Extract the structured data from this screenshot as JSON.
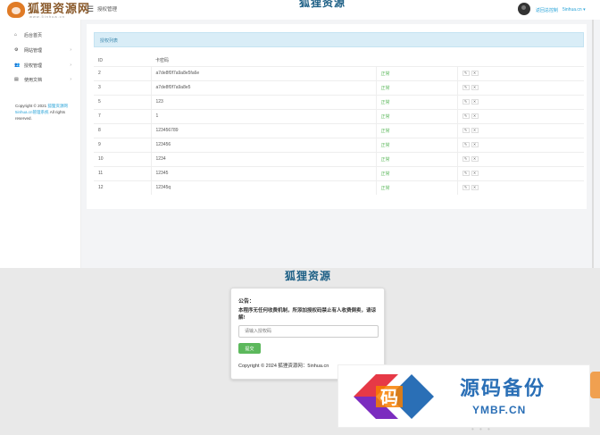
{
  "header": {
    "logo_text": "狐狸资源网",
    "logo_sub": "www.5inhua.cn",
    "breadcrumb": "授权管理",
    "watermark": "狐狸资源",
    "user_link": "返回总控制",
    "user_name": "5inhua.cn ▾"
  },
  "sidebar": {
    "items": [
      {
        "icon": "home-icon",
        "glyph": "⌂",
        "label": "后台首页",
        "has_arrow": false
      },
      {
        "icon": "settings-icon",
        "glyph": "⚙",
        "label": "网站管理",
        "has_arrow": true
      },
      {
        "icon": "users-icon",
        "glyph": "👥",
        "label": "授权管理",
        "has_arrow": true
      },
      {
        "icon": "doc-icon",
        "glyph": "▤",
        "label": "使用文档",
        "has_arrow": true
      }
    ],
    "copyright_prefix": "Copyright © 2021 ",
    "copyright_link1": "狐狸资源网",
    "copyright_link2": "5inhua.cn",
    "copyright_mid": "管理系统",
    "copyright_suffix": " All rights reserved."
  },
  "panel": {
    "title": "授权列表",
    "columns": [
      "ID",
      "卡密码",
      "",
      ""
    ],
    "rows": [
      {
        "id": "2",
        "code": "a7de8f0f7a9a8e5fa6e",
        "status": "正常"
      },
      {
        "id": "3",
        "code": "a7de8f0f7a9a8e5",
        "status": "正常"
      },
      {
        "id": "5",
        "code": "123",
        "status": "正常"
      },
      {
        "id": "7",
        "code": "1",
        "status": "正常"
      },
      {
        "id": "8",
        "code": "123456789",
        "status": "正常"
      },
      {
        "id": "9",
        "code": "123456",
        "status": "正常"
      },
      {
        "id": "10",
        "code": "1234",
        "status": "正常"
      },
      {
        "id": "11",
        "code": "12345",
        "status": "正常"
      },
      {
        "id": "12",
        "code": "12345q",
        "status": "正常"
      }
    ],
    "edit_glyph": "✎",
    "delete_glyph": "✕"
  },
  "bottom": {
    "brand": "狐狸资源",
    "card_title": "公告：",
    "notice": "本程序无任何收费机制，所添加授权码禁止有人收费倒卖，请谅解!",
    "input_placeholder": "请输入授权码",
    "submit_label": "提交",
    "copyright": "Copyright © 2024 狐狸资源网：5inhua.cn"
  },
  "ad": {
    "logo_glyph": "码",
    "main": "源码备份",
    "sub": "YMBF.CN",
    "dots": "• • •"
  }
}
